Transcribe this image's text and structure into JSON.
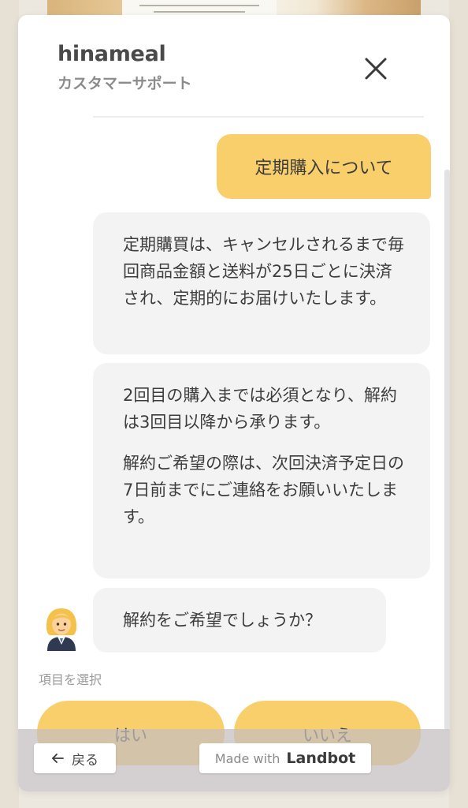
{
  "header": {
    "brand_name": "hinameal",
    "subtitle": "カスタマーサポート",
    "close_icon": "close-icon"
  },
  "messages": {
    "user_message": "定期購入について",
    "bot_message_1": "定期購買は、キャンセルされるまで毎回商品金額と送料が25日ごとに決済され、定期的にお届けいたします。",
    "bot_message_2_part_1": "2回目の購入までは必須となり、解約は3回目以降から承ります。",
    "bot_message_2_part_2": "解約ご希望の際は、次回決済予定日の7日前までにご連絡をお願いいたします。",
    "bot_message_3": "解約をご希望でしょうか？",
    "avatar_icon": "woman-office-worker-icon"
  },
  "options": {
    "hint": "項目を選択",
    "yes_label": "はい",
    "no_label": "いいえ"
  },
  "footer": {
    "back_label": "戻る",
    "made_with_text": "Made with",
    "made_with_brand": "Landbot"
  },
  "colors": {
    "accent": "#f9cf6c",
    "bot_bubble": "#f3f3f3",
    "text": "#3d3d3d"
  }
}
